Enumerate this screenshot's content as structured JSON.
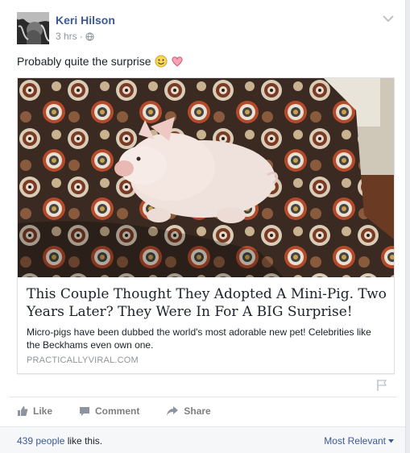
{
  "post": {
    "author": "Keri Hilson",
    "time": "3 hrs",
    "dot": "·",
    "status_text": "Probably quite the surprise"
  },
  "link_preview": {
    "headline": "This Couple Thought They Adopted A Mini-Pig. Two Years Later? They Were In For A BIG Surprise!",
    "description": "Micro-pigs have been dubbed the world's most adorable new pet! Celebrities like the Beckhams even own one.",
    "domain": "PRACTICALLYVIRAL.COM"
  },
  "actions": {
    "like": "Like",
    "comment": "Comment",
    "share": "Share"
  },
  "footer": {
    "likes_count_link": "439 people",
    "likes_suffix": " like this.",
    "sort_label": "Most Relevant"
  },
  "icons": {
    "globe": "globe-icon",
    "smile": "smile-emoji-icon",
    "heart": "heart-emoji-icon",
    "chevron": "chevron-down-icon",
    "flag": "flag-icon",
    "like": "thumbs-up-icon",
    "comment": "comment-icon",
    "share": "share-arrow-icon"
  },
  "colors": {
    "link": "#3b5998",
    "muted": "#90949c",
    "heart": "#e8718d"
  }
}
